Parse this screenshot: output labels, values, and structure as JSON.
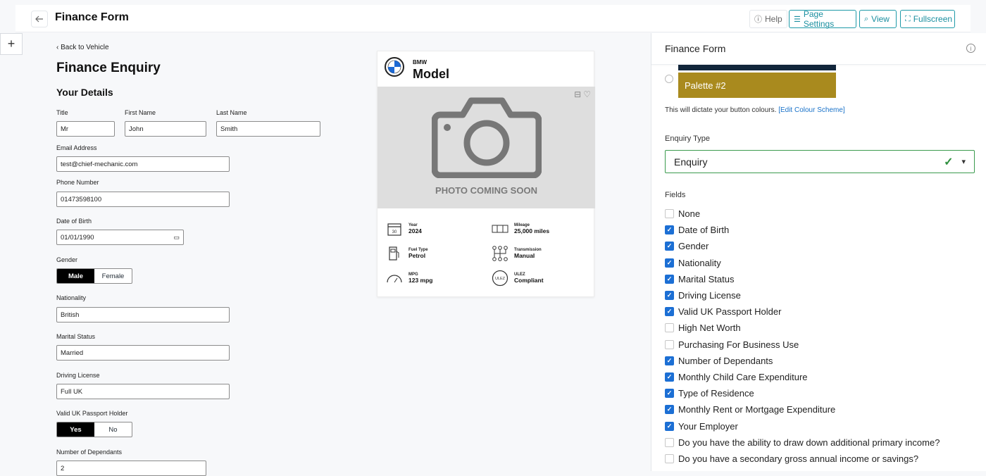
{
  "topbar": {
    "title": "Finance Form",
    "help": "Help",
    "page_settings": "Page Settings",
    "view": "View",
    "fullscreen": "Fullscreen"
  },
  "form": {
    "back": "Back to Vehicle",
    "heading": "Finance Enquiry",
    "section": "Your Details",
    "title_label": "Title",
    "title_value": "Mr",
    "first_label": "First Name",
    "first_value": "John",
    "last_label": "Last Name",
    "last_value": "Smith",
    "email_label": "Email Address",
    "email_value": "test@chief-mechanic.com",
    "phone_label": "Phone Number",
    "phone_value": "01473598100",
    "dob_label": "Date of Birth",
    "dob_value": "01/01/1990",
    "gender_label": "Gender",
    "gender_male": "Male",
    "gender_female": "Female",
    "nationality_label": "Nationality",
    "nationality_value": "British",
    "marital_label": "Marital Status",
    "marital_value": "Married",
    "license_label": "Driving License",
    "license_value": "Full UK",
    "passport_label": "Valid UK Passport Holder",
    "yes": "Yes",
    "no": "No",
    "dependants_label": "Number of Dependants",
    "dependants_value": "2"
  },
  "vehicle": {
    "make": "BMW",
    "model": "Model",
    "photo_text": "PHOTO COMING SOON",
    "specs": {
      "year_k": "Year",
      "year_v": "2024",
      "mileage_k": "Mileage",
      "mileage_v": "25,000 miles",
      "fuel_k": "Fuel Type",
      "fuel_v": "Petrol",
      "trans_k": "Transmission",
      "trans_v": "Manual",
      "mpg_k": "MPG",
      "mpg_v": "123 mpg",
      "ulez_k": "ULEZ",
      "ulez_v": "Compliant"
    }
  },
  "panel": {
    "title": "Finance Form",
    "palette2": "Palette #2",
    "dictate": "This will dictate your button colours.",
    "edit_link": "[Edit Colour Scheme]",
    "enquiry_type_label": "Enquiry Type",
    "enquiry_type_value": "Enquiry",
    "fields_label": "Fields",
    "fields": [
      {
        "label": "None",
        "checked": false
      },
      {
        "label": "Date of Birth",
        "checked": true
      },
      {
        "label": "Gender",
        "checked": true
      },
      {
        "label": "Nationality",
        "checked": true
      },
      {
        "label": "Marital Status",
        "checked": true
      },
      {
        "label": "Driving License",
        "checked": true
      },
      {
        "label": "Valid UK Passport Holder",
        "checked": true
      },
      {
        "label": "High Net Worth",
        "checked": false
      },
      {
        "label": "Purchasing For Business Use",
        "checked": false
      },
      {
        "label": "Number of Dependants",
        "checked": true
      },
      {
        "label": "Monthly Child Care Expenditure",
        "checked": true
      },
      {
        "label": "Type of Residence",
        "checked": true
      },
      {
        "label": "Monthly Rent or Mortgage Expenditure",
        "checked": true
      },
      {
        "label": "Your Employer",
        "checked": true
      },
      {
        "label": "Do you have the ability to draw down additional primary income?",
        "checked": false
      },
      {
        "label": "Do you have a secondary gross annual income or savings?",
        "checked": false
      }
    ]
  },
  "colors": {
    "accent": "#1e9aa8",
    "palette1": "#12263b",
    "palette2": "#a98a1e",
    "check": "#1c6fd4",
    "valid": "#2e8f3e"
  }
}
